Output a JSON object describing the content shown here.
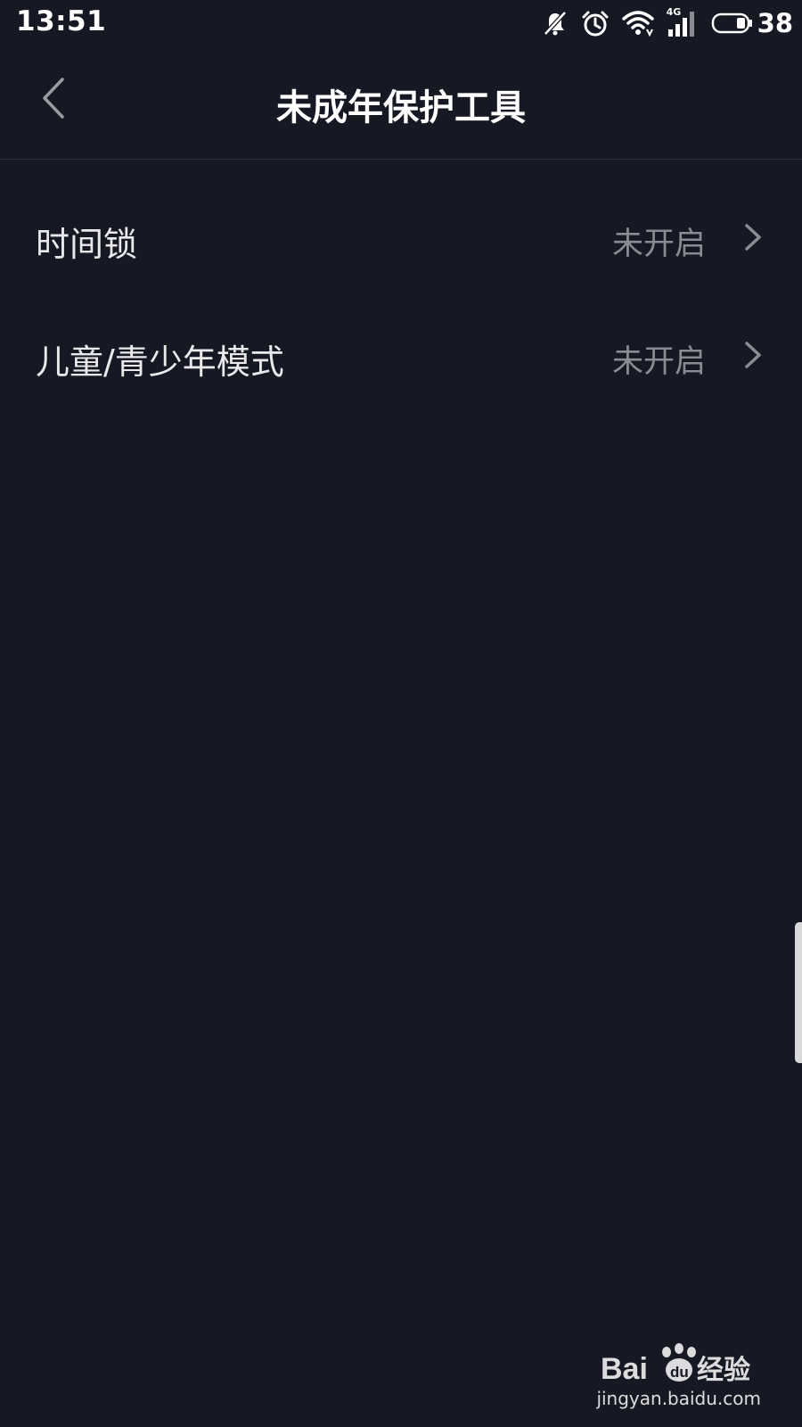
{
  "status_bar": {
    "time": "13:51",
    "network_type": "4G",
    "battery_level": "38",
    "icons": [
      "bell-muted-icon",
      "alarm-icon",
      "wifi-icon",
      "signal-4g-icon",
      "battery-icon"
    ]
  },
  "header": {
    "title": "未成年保护工具",
    "back_icon": "chevron-left-icon"
  },
  "settings": {
    "items": [
      {
        "label": "时间锁",
        "value": "未开启",
        "icon": "chevron-right-icon"
      },
      {
        "label": "儿童/青少年模式",
        "value": "未开启",
        "icon": "chevron-right-icon"
      }
    ]
  },
  "watermark": {
    "brand": "Baidu经验",
    "domain": "jingyan.baidu.com"
  },
  "colors": {
    "background": "#161823",
    "title_text": "#ffffff",
    "label_text": "#e9e9eb",
    "value_text": "#8b8c93",
    "chevron": "#8b8c93"
  }
}
